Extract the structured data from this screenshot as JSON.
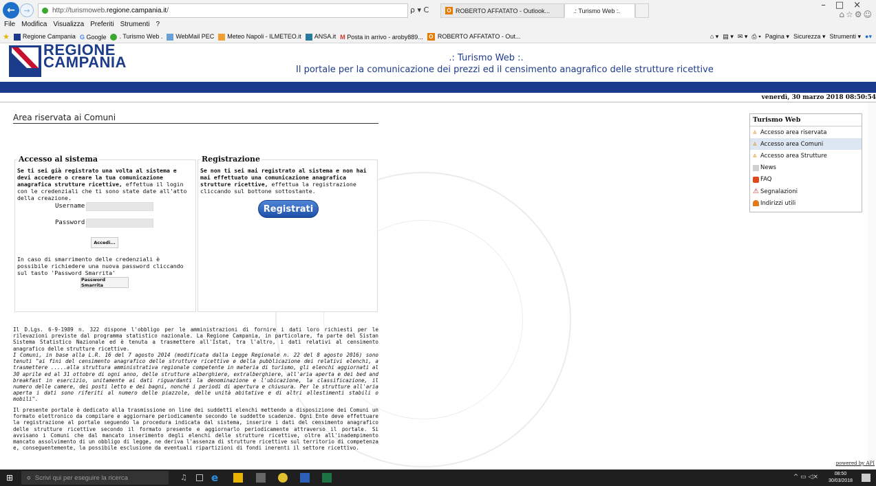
{
  "browser": {
    "url_prefix": "http://turismoweb.",
    "url_domain": "regione.campania.it",
    "url_suffix": "/",
    "addr_controls": "ρ ▾ C",
    "tabs": [
      {
        "label": "ROBERTO AFFATATO - Outlook..."
      },
      {
        "label": ".: Turismo Web :."
      }
    ],
    "menu": [
      "File",
      "Modifica",
      "Visualizza",
      "Preferiti",
      "Strumenti",
      "?"
    ],
    "favorites": [
      "Regione Campania",
      "Google",
      ". Turismo Web .",
      "WebMail PEC",
      "Meteo Napoli - ILMETEO.it",
      "ANSA.it",
      "Posta in arrivo - aroby889...",
      "ROBERTO AFFATATO - Out..."
    ],
    "commands": [
      "Pagina ▾",
      "Sicurezza ▾",
      "Strumenti ▾"
    ]
  },
  "site": {
    "logo_line1": "REGIONE",
    "logo_line2": "CAMPANIA",
    "title": ".: Turismo Web :.",
    "subtitle": "Il portale per la comunicazione dei prezzi ed il censimento anagrafico delle strutture ricettive",
    "date": "venerdì, 30 marzo 2018 08:50:54"
  },
  "main": {
    "title": "Area riservata ai Comuni",
    "access": {
      "heading": "Accesso al sistema",
      "intro_bold": "Se ti sei già registrato una volta al sistema e devi accedere o creare la tua comunicazione anagrafica strutture ricettive,",
      "intro_rest": " effettua il login con le credenziali che ti sono state date all'atto della creazione.",
      "username_label": "Username:",
      "password_label": "Password:",
      "login_button": "Accedi...",
      "lost_text": "In caso di smarrimento delle credenziali è possibile richiedere una nuova password cliccando sul tasto 'Password Smarrita'",
      "lost_button": "Password Smarrita"
    },
    "registration": {
      "heading": "Registrazione",
      "intro_bold": "Se non ti sei mai registrato al sistema e non hai mai effettuato una comunicazione anagrafica strutture ricettive,",
      "intro_rest": " effettua la registrazione cliccando sul bottone sottostante.",
      "button": "Registrati"
    },
    "para1": "Il D.Lgs. 6-9-1989 n. 322 dispone l'obbligo per le amministrazioni di fornire i dati loro richiesti per le rilevazioni previste dal programma statistico nazionale. La Regione Campania, in particolare, fa parte del Sistan Sistema Statistico Nazionale ed è tenuta a trasmettere all'Istat, tra l'altro, i dati relativi al censimento anagrafico delle strutture ricettive.",
    "para2": "I Comuni, in base alla L.R. 16 del 7 agosto 2014 (modificata dalla Legge Regionale n. 22 del 8 agosto 2016) sono tenuti \"ai fini del censimento anagrafico delle strutture ricettive e della pubblicazione dei relativi elenchi, a trasmettere .....alla struttura amministrativa regionale competente in materia di turismo, gli elenchi aggiornati al 30 aprile ed al 31 ottobre di ogni anno, delle strutture alberghiere, extralberghiere, all'aria aperta e dei bed and breakfast in esercizio, unitamente ai dati riguardanti la denominazione e l'ubicazione, la classificazione, il numero delle camere, dei posti letto e dei bagni, nonché i periodi di apertura e chiusura. Per le strutture all'aria aperta i dati sono riferiti al numero delle piazzole, delle unità abitative e di altri allestimenti stabili o mobili\".",
    "para3": "Il presente portale è dedicato alla trasmissione on line dei suddetti elenchi mettendo a disposizione dei Comuni un formato elettronico da compilare e aggiornare periodicamente secondo le suddette scadenze. Ogni Ente deve effettuare la registrazione al portale seguendo la procedura indicata dal sistema, inserire i dati del censimento anagrafico delle strutture ricettive secondo il formato presente e aggiornarlo periodicamente attraverso il portale. Si avvisano i Comuni che dal mancato inserimento degli elenchi delle strutture ricettive, oltre all'inadempimento mancato assolvimento di un obbligo di legge, ne deriva l'assenza di strutture ricettive sul territorio di competenza e, conseguentemente, la possibile esclusione da eventuali ripartizioni di fondi inerenti il settore ricettivo."
  },
  "sidebar": {
    "title": "Turismo Web",
    "items": [
      {
        "label": "Accesso area riservata",
        "icon": "key-icon",
        "color": "#e0962a"
      },
      {
        "label": "Accesso area Comuni",
        "icon": "key-icon",
        "color": "#e0962a"
      },
      {
        "label": "Accesso area Strutture",
        "icon": "key-icon",
        "color": "#e0962a"
      },
      {
        "label": "News",
        "icon": "news-icon",
        "color": "#999999"
      },
      {
        "label": "FAQ",
        "icon": "faq-icon",
        "color": "#e04a1a"
      },
      {
        "label": "Segnalazioni",
        "icon": "warning-icon",
        "color": "#d81e1e"
      },
      {
        "label": "Indirizzi utili",
        "icon": "book-icon",
        "color": "#e07a1a"
      }
    ]
  },
  "footer": {
    "powered": "powered by API"
  },
  "taskbar": {
    "search_placeholder": "Scrivi qui per eseguire la ricerca",
    "time": "08:50",
    "date": "30/03/2018"
  },
  "colors": {
    "brand_blue": "#1b3a8c",
    "button_blue": "#1d4fa6"
  }
}
